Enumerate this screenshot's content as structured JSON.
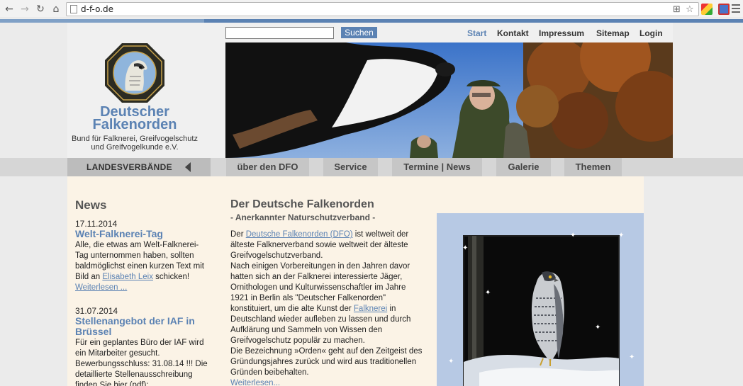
{
  "browser": {
    "url": "d-f-o.de",
    "back_icon": "←",
    "forward_icon": "→",
    "reload_icon": "↻",
    "home_icon": "⌂",
    "star_icon": "☆",
    "translate_icon": "⊞"
  },
  "header": {
    "brand_line1": "Deutscher",
    "brand_line2": "Falkenorden",
    "tagline_line1": "Bund für Falknerei, Greifvogelschutz",
    "tagline_line2": "und Greifvogelkunde e.V.",
    "logo_text": "Deutscher Falkenorden"
  },
  "search": {
    "value": "",
    "placeholder": "",
    "button_label": "Suchen"
  },
  "top_nav": [
    {
      "label": "Start",
      "active": true
    },
    {
      "label": "Kontakt"
    },
    {
      "label": "Impressum"
    },
    {
      "label": "Sitemap"
    },
    {
      "label": "Login"
    }
  ],
  "main_nav": {
    "landesverbaende": "LANDESVERBÄNDE",
    "tabs": [
      "über den DFO",
      "Service",
      "Termine | News",
      "Galerie",
      "Themen"
    ]
  },
  "news": {
    "heading": "News",
    "items": [
      {
        "date": "17.11.2014",
        "title": "Welt-Falknerei-Tag",
        "text_before": "Alle, die etwas am Welt-Falknerei-Tag unternommen haben, sollten baldmöglichst einen kurzen Text mit Bild an ",
        "link": "Elisabeth Leix",
        "text_after": " schicken!",
        "more": "Weiterlesen ..."
      },
      {
        "date": "31.07.2014",
        "title_line1": "Stellenangebot der IAF in",
        "title_line2": "Brüssel",
        "text": "Für ein geplantes Büro der IAF wird ein Mitarbeiter gesucht. Bewerbungsschluss: 31.08.14 !!! Die detaillierte Stellenausschreibung finden Sie hier (pdf):"
      }
    ]
  },
  "main": {
    "heading": "Der Deutsche Falkenorden",
    "subheading": "- Anerkannter Naturschutzverband -",
    "p1_before": "Der ",
    "p1_link": "Deutsche Falkenorden (DFO)",
    "p1_after": " ist weltweit der älteste Falknerverband sowie weltweit der älteste Greifvogelschutzverband.",
    "p2_before": "Nach einigen Vorbereitungen in den Jahren davor hatten sich an der Falknerei interessierte Jäger, Ornithologen und Kulturwissenschaftler im Jahre 1921 in Berlin als \"Deutscher Falkenorden\" konstituiert, um die alte Kunst der ",
    "p2_link": "Falknerei",
    "p2_after": " in Deutschland wieder aufleben zu lassen und durch Aufklärung und Sammeln von Wissen den Greifvogelschutz populär zu machen.",
    "p3": "Die Bezeichnung »Orden« geht auf den Zeitgeist des Gründungsjahres zurück und wird aus traditionellen Gründen beibehalten.",
    "more": "Weiterlesen..."
  },
  "colors": {
    "brand_blue": "#5b82b3",
    "content_bg": "#fbf3e6",
    "nav_tab": "#c6c6c6"
  }
}
